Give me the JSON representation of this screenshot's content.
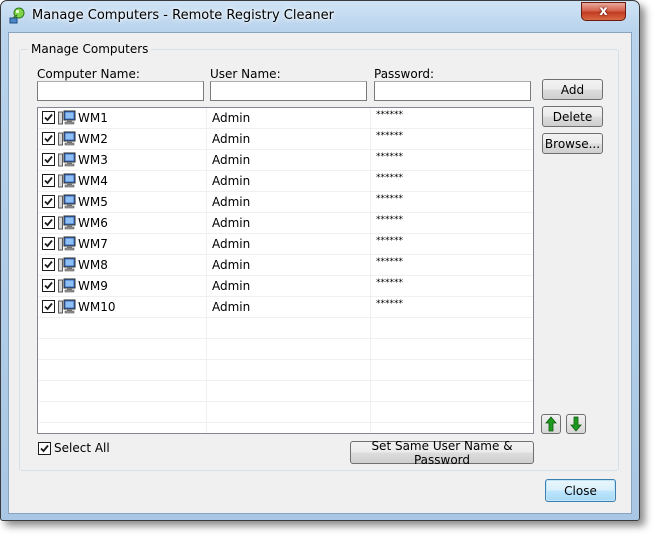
{
  "window": {
    "title": "Manage Computers - Remote Registry Cleaner",
    "close_glyph": "x"
  },
  "group": {
    "label": "Manage Computers"
  },
  "form": {
    "computer_name_label": "Computer Name:",
    "computer_name_value": "",
    "user_name_label": "User Name:",
    "user_name_value": "",
    "password_label": "Password:",
    "password_value": ""
  },
  "buttons": {
    "add": "Add",
    "delete": "Delete",
    "browse": "Browse...",
    "set_same": "Set Same User Name & Password",
    "close": "Close"
  },
  "select_all": {
    "label": "Select All",
    "checked": true
  },
  "computers": [
    {
      "name": "WM1",
      "user": "Admin",
      "password": "******",
      "checked": true
    },
    {
      "name": "WM2",
      "user": "Admin",
      "password": "******",
      "checked": true
    },
    {
      "name": "WM3",
      "user": "Admin",
      "password": "******",
      "checked": true
    },
    {
      "name": "WM4",
      "user": "Admin",
      "password": "******",
      "checked": true
    },
    {
      "name": "WM5",
      "user": "Admin",
      "password": "******",
      "checked": true
    },
    {
      "name": "WM6",
      "user": "Admin",
      "password": "******",
      "checked": true
    },
    {
      "name": "WM7",
      "user": "Admin",
      "password": "******",
      "checked": true
    },
    {
      "name": "WM8",
      "user": "Admin",
      "password": "******",
      "checked": true
    },
    {
      "name": "WM9",
      "user": "Admin",
      "password": "******",
      "checked": true
    },
    {
      "name": "WM10",
      "user": "Admin",
      "password": "******",
      "checked": true
    }
  ],
  "icons": {
    "app": "remote-registry-icon",
    "computer": "computer-icon",
    "move_up": "arrow-up-icon",
    "move_down": "arrow-down-icon"
  },
  "colors": {
    "arrow_green": "#1e9a1e",
    "title_gradient_top": "#cfe3f5",
    "close_red": "#c23b21"
  }
}
